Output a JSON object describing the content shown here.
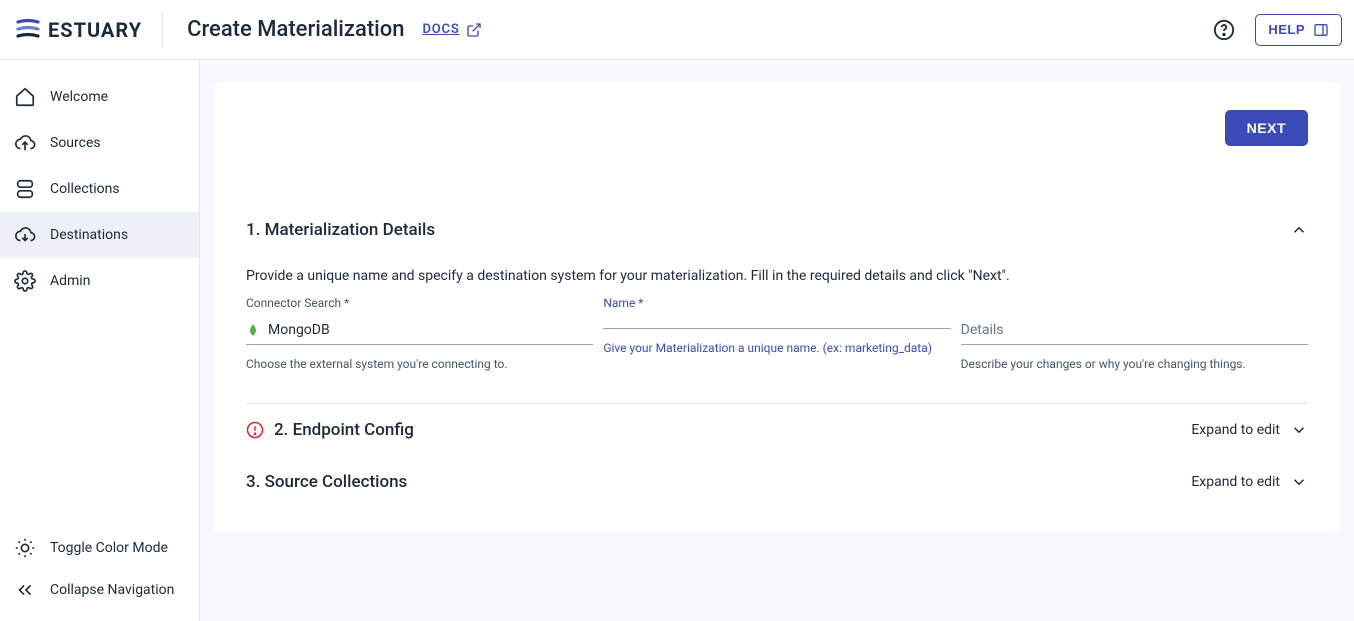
{
  "header": {
    "logo_text": "ESTUARY",
    "page_title": "Create Materialization",
    "docs_label": "DOCS",
    "help_label": "HELP"
  },
  "sidebar": {
    "items": [
      {
        "label": "Welcome"
      },
      {
        "label": "Sources"
      },
      {
        "label": "Collections"
      },
      {
        "label": "Destinations"
      },
      {
        "label": "Admin"
      }
    ],
    "footer": {
      "toggle_color": "Toggle Color Mode",
      "collapse_nav": "Collapse Navigation"
    }
  },
  "main": {
    "next_label": "NEXT",
    "section1": {
      "title": "1. Materialization Details",
      "description": "Provide a unique name and specify a destination system for your materialization. Fill in the required details and click \"Next\".",
      "connector": {
        "label": "Connector Search",
        "value": "MongoDB",
        "helper": "Choose the external system you're connecting to."
      },
      "name": {
        "label": "Name",
        "helper": "Give your Materialization a unique name. (ex: marketing_data)"
      },
      "details": {
        "placeholder": "Details",
        "helper": "Describe your changes or why you're changing things."
      }
    },
    "section2": {
      "title": "2. Endpoint Config",
      "action": "Expand to edit"
    },
    "section3": {
      "title": "3. Source Collections",
      "action": "Expand to edit"
    }
  }
}
